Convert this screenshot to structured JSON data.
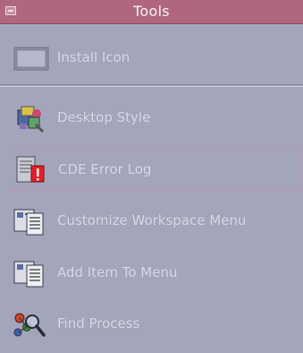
{
  "title": "Tools",
  "items": [
    {
      "label": "Install Icon"
    },
    {
      "label": "Desktop Style"
    },
    {
      "label": "CDE Error Log"
    },
    {
      "label": "Customize Workspace Menu"
    },
    {
      "label": "Add Item To Menu"
    },
    {
      "label": "Find Process"
    }
  ],
  "colors": {
    "titlebar": "#b0667e",
    "panel": "#a3a6bb",
    "label": "#d8dae5",
    "selection_border": "#c493ab",
    "error_red": "#e0202a"
  }
}
